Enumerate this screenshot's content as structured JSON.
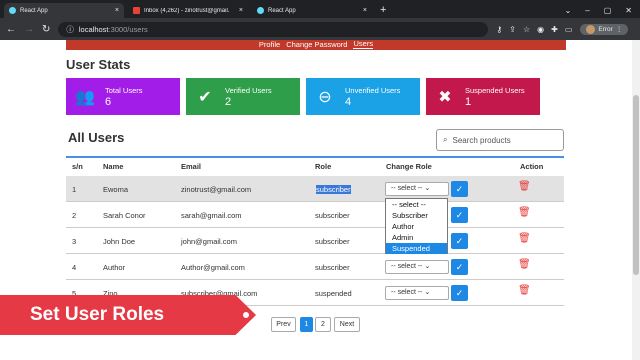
{
  "browser": {
    "tabs": [
      {
        "title": "React App",
        "icon": "react-icon"
      },
      {
        "title": "Inbox (4,262) - zinotrust@gmail.com - G",
        "icon": "gmail-icon"
      },
      {
        "title": "React App",
        "icon": "react-icon"
      }
    ],
    "url_host": "localhost",
    "url_path": ":3000/users",
    "profile_label": "Error"
  },
  "subnav": {
    "items": [
      "Profile",
      "Change Password",
      "Users"
    ],
    "active": "Users"
  },
  "stats": {
    "title": "User Stats",
    "cards": [
      {
        "label": "Total Users",
        "value": "6",
        "color": "#a21ee8",
        "icon": "users-icon"
      },
      {
        "label": "Verified Users",
        "value": "2",
        "color": "#2e9e4a",
        "icon": "user-check-icon"
      },
      {
        "label": "Unverified Users",
        "value": "4",
        "color": "#1ba1e6",
        "icon": "user-minus-icon"
      },
      {
        "label": "Suspended Users",
        "value": "1",
        "color": "#c2184b",
        "icon": "user-x-icon"
      }
    ]
  },
  "users": {
    "title": "All Users",
    "search_placeholder": "Search products",
    "columns": [
      "s/n",
      "Name",
      "Email",
      "Role",
      "Change Role",
      "Action"
    ],
    "rows": [
      {
        "sn": "1",
        "name": "Ewoma",
        "email": "zinotrust@gmail.com",
        "role": "subscriber",
        "select": "-- select --"
      },
      {
        "sn": "2",
        "name": "Sarah Conor",
        "email": "sarah@gmail.com",
        "role": "subscriber",
        "select": "-- select --"
      },
      {
        "sn": "3",
        "name": "John Doe",
        "email": "john@gmail.com",
        "role": "subscriber",
        "select": "-- select --"
      },
      {
        "sn": "4",
        "name": "Author",
        "email": "Author@gmail.com",
        "role": "subscriber",
        "select": "-- select --"
      },
      {
        "sn": "5",
        "name": "Zino",
        "email": "subscriber@gmail.com",
        "role": "suspended",
        "select": "-- select --"
      }
    ],
    "dropdown_options": [
      "-- select --",
      "Subscriber",
      "Author",
      "Admin",
      "Suspended"
    ],
    "dropdown_highlighted": "Suspended"
  },
  "pagination": {
    "prev": "Prev",
    "pages": [
      "1",
      "2"
    ],
    "active": "1",
    "next": "Next"
  },
  "banner": {
    "text": "Set User Roles"
  }
}
